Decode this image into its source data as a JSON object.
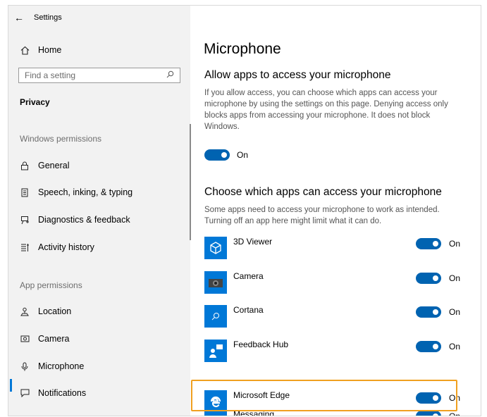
{
  "window": {
    "title": "Settings"
  },
  "sidebar": {
    "home_label": "Home",
    "search_placeholder": "Find a setting",
    "category": "Privacy",
    "windows_permissions_label": "Windows permissions",
    "windows_items": [
      {
        "label": "General",
        "icon": "lock-icon"
      },
      {
        "label": "Speech, inking, & typing",
        "icon": "speech-icon"
      },
      {
        "label": "Diagnostics & feedback",
        "icon": "diagnostics-icon"
      },
      {
        "label": "Activity history",
        "icon": "activity-icon"
      }
    ],
    "app_permissions_label": "App permissions",
    "app_items": [
      {
        "label": "Location",
        "icon": "location-icon"
      },
      {
        "label": "Camera",
        "icon": "camera-icon"
      },
      {
        "label": "Microphone",
        "icon": "microphone-icon",
        "selected": true
      },
      {
        "label": "Notifications",
        "icon": "notifications-icon"
      }
    ]
  },
  "main": {
    "title": "Microphone",
    "allow": {
      "heading": "Allow apps to access your microphone",
      "description": "If you allow access, you can choose which apps can access your microphone by using the settings on this page. Denying access only blocks apps from accessing your microphone. It does not block Windows.",
      "toggle_label": "On"
    },
    "choose": {
      "heading": "Choose which apps can access your microphone",
      "description": "Some apps need to access your microphone to work as intended. Turning off an app here might limit what it can do."
    },
    "apps": [
      {
        "name": "3D Viewer",
        "state": "On"
      },
      {
        "name": "Camera",
        "state": "On"
      },
      {
        "name": "Cortana",
        "state": "On"
      },
      {
        "name": "Feedback Hub",
        "state": "On"
      },
      {
        "name": "Microsoft Edge",
        "state": "On"
      },
      {
        "name": "Messaging",
        "state": "On"
      }
    ]
  },
  "colors": {
    "accent": "#0078d7",
    "toggle_on": "#0063b1",
    "highlight": "#f0a020"
  }
}
